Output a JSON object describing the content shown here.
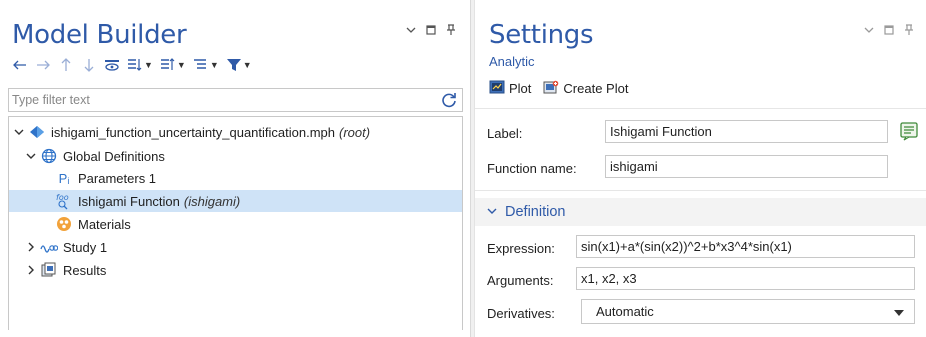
{
  "model_builder": {
    "title": "Model Builder",
    "filter_placeholder": "Type filter text",
    "tree": [
      {
        "label": "ishigami_function_uncertainty_quantification.mph",
        "suffix": "(root)"
      },
      {
        "label": "Global Definitions",
        "suffix": ""
      },
      {
        "label": "Parameters 1",
        "suffix": ""
      },
      {
        "label": "Ishigami Function",
        "suffix": "(ishigami)"
      },
      {
        "label": "Materials",
        "suffix": ""
      },
      {
        "label": "Study 1",
        "suffix": ""
      },
      {
        "label": "Results",
        "suffix": ""
      }
    ],
    "param_icon_text": "P",
    "param_icon_sub": "i",
    "func_icon_text": "f(x)"
  },
  "settings": {
    "title": "Settings",
    "subtitle": "Analytic",
    "plot_label": "Plot",
    "create_plot_label": "Create Plot",
    "label_caption": "Label:",
    "label_value": "Ishigami Function",
    "function_name_caption": "Function name:",
    "function_name_value": "ishigami",
    "section_title": "Definition",
    "expression_caption": "Expression:",
    "expression_value": "sin(x1)+a*(sin(x2))^2+b*x3^4*sin(x1)",
    "arguments_caption": "Arguments:",
    "arguments_value": "x1, x2, x3",
    "derivatives_caption": "Derivatives:",
    "derivatives_value": "Automatic"
  },
  "colors": {
    "accent": "#2f5aa8",
    "selection": "#cfe3f7"
  }
}
